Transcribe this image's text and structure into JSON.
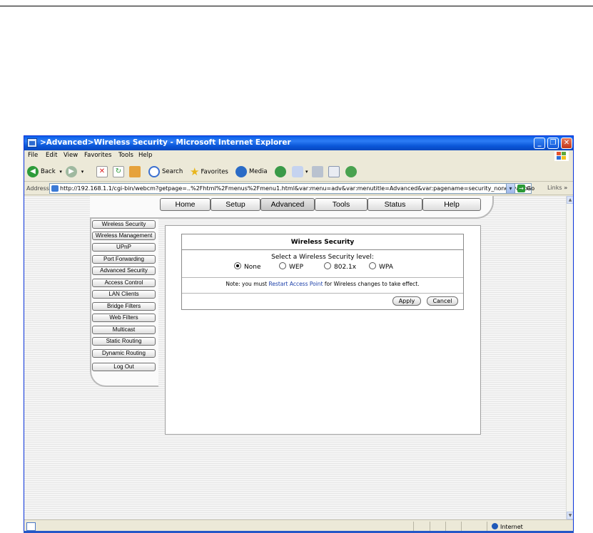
{
  "window": {
    "title": ">Advanced>Wireless Security - Microsoft Internet Explorer",
    "controls": {
      "minimize": "_",
      "maximize": "❐",
      "close": "✕"
    }
  },
  "menubar": {
    "items": [
      "File",
      "Edit",
      "View",
      "Favorites",
      "Tools",
      "Help"
    ]
  },
  "toolbar": {
    "back": "Back",
    "search": "Search",
    "favorites": "Favorites",
    "media": "Media",
    "icons": [
      "back-icon",
      "forward-icon",
      "stop-icon",
      "refresh-icon",
      "home-icon",
      "search-icon",
      "favorites-icon",
      "media-icon",
      "history-icon",
      "mail-icon",
      "print-icon",
      "edit-icon",
      "messenger-icon"
    ]
  },
  "addressbar": {
    "label": "Address",
    "url": "http://192.168.1.1/cgi-bin/webcm?getpage=..%2Fhtml%2Fmenus%2Fmenu1.html&var:menu=adv&var:menutitle=Advanced&var:pagename=security_none&var:pagetitl",
    "go": "Go",
    "links": "Links"
  },
  "nav": {
    "tabs": [
      "Home",
      "Setup",
      "Advanced",
      "Tools",
      "Status",
      "Help"
    ],
    "active": "Advanced"
  },
  "sidebar": {
    "items": [
      "Wireless Security",
      "Wireless Management",
      "UPnP",
      "Port Forwarding",
      "Advanced Security",
      "Access Control",
      "LAN Clients",
      "Bridge Filters",
      "Web Filters",
      "Multicast",
      "Static Routing",
      "Dynamic Routing",
      "Log Out"
    ]
  },
  "security": {
    "title": "Wireless Security",
    "prompt": "Select a Wireless Security level:",
    "options": [
      "None",
      "WEP",
      "802.1x",
      "WPA"
    ],
    "selected": "None",
    "note_prefix": "Note: you must ",
    "note_link": "Restart Access Point",
    "note_suffix": " for Wireless changes to take effect.",
    "apply": "Apply",
    "cancel": "Cancel"
  },
  "statusbar": {
    "zone": "Internet"
  }
}
